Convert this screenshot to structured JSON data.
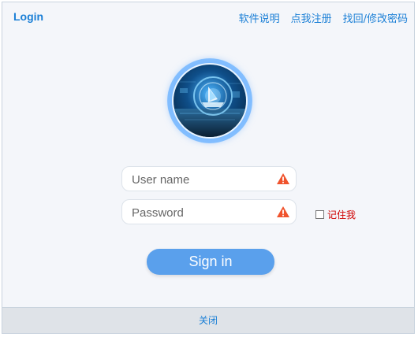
{
  "window": {
    "title": "Login"
  },
  "top_links": {
    "help": "软件说明",
    "register": "点我注册",
    "recover": "找回/修改密码"
  },
  "avatar": {
    "icon": "network-ship-avatar"
  },
  "form": {
    "username_placeholder": "User name",
    "password_placeholder": "Password",
    "remember_label": "记住我",
    "remember_checked": false,
    "signin_label": "Sign in"
  },
  "footer": {
    "close_label": "关闭"
  },
  "colors": {
    "accent": "#1a7fd6",
    "button": "#5aa0ec",
    "warning": "#f0532d",
    "remember_text": "#d00000",
    "footer_bg": "#dfe3e8"
  }
}
